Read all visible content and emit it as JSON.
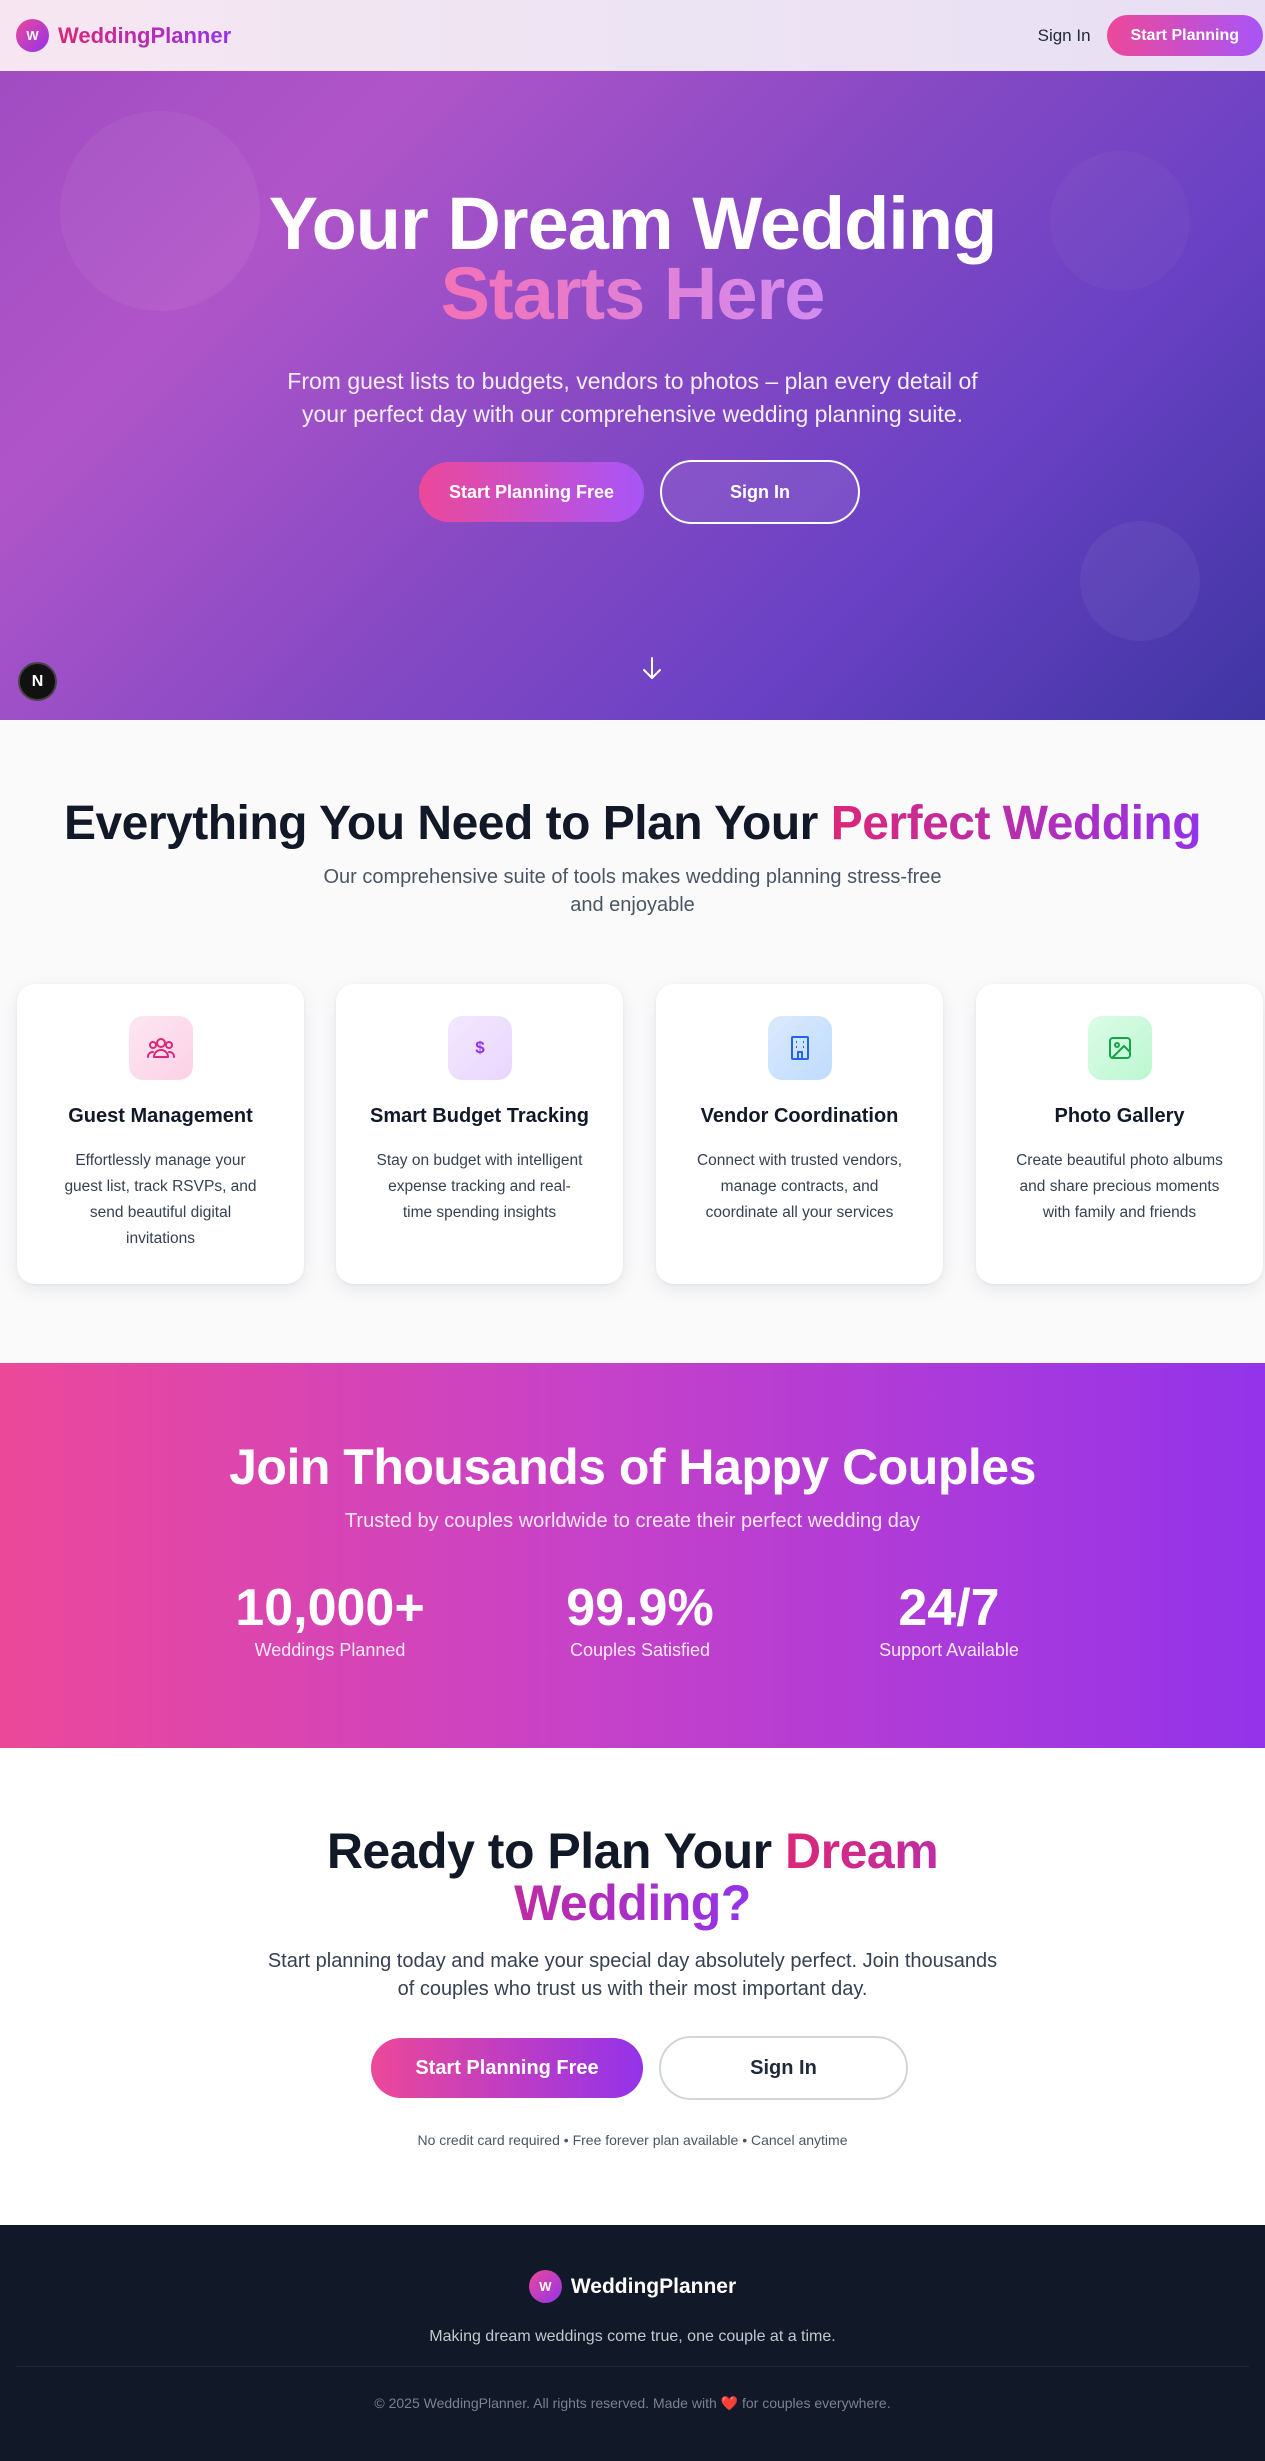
{
  "header": {
    "logo_letter": "W",
    "brand": "WeddingPlanner",
    "signin_label": "Sign In",
    "cta_label": "Start Planning"
  },
  "hero": {
    "title_line1": "Your Dream Wedding",
    "title_line2": "Starts Here",
    "subtitle": "From guest lists to budgets, vendors to photos – plan every detail of your perfect day with our comprehensive wedding planning suite.",
    "primary_button": "Start Planning Free",
    "secondary_button": "Sign In",
    "badge_letter": "N",
    "scroll_icon": "arrow-down-icon"
  },
  "features": {
    "title_plain": "Everything You Need to Plan Your ",
    "title_highlight": "Perfect Wedding",
    "subtitle": "Our comprehensive suite of tools makes wedding planning stress-free and enjoyable",
    "cards": [
      {
        "icon": "users-icon",
        "title": "Guest Management",
        "description": "Effortlessly manage your guest list, track RSVPs, and send beautiful digital invitations"
      },
      {
        "icon": "dollar-icon",
        "title": "Smart Budget Tracking",
        "description": "Stay on budget with intelligent expense tracking and real-time spending insights"
      },
      {
        "icon": "building-icon",
        "title": "Vendor Coordination",
        "description": "Connect with trusted vendors, manage contracts, and coordinate all your services"
      },
      {
        "icon": "image-icon",
        "title": "Photo Gallery",
        "description": "Create beautiful photo albums and share precious moments with family and friends"
      }
    ],
    "dollar_glyph": "$"
  },
  "stats": {
    "title": "Join Thousands of Happy Couples",
    "subtitle": "Trusted by couples worldwide to create their perfect wedding day",
    "items": [
      {
        "value": "10,000+",
        "label": "Weddings Planned"
      },
      {
        "value": "99.9%",
        "label": "Couples Satisfied"
      },
      {
        "value": "24/7",
        "label": "Support Available"
      }
    ]
  },
  "cta": {
    "title_plain": "Ready to Plan Your ",
    "title_highlight": "Dream Wedding?",
    "subtitle": "Start planning today and make your special day absolutely perfect. Join thousands of couples who trust us with their most important day.",
    "primary_button": "Start Planning Free",
    "secondary_button": "Sign In",
    "note": "No credit card required • Free forever plan available • Cancel anytime"
  },
  "footer": {
    "logo_letter": "W",
    "brand": "WeddingPlanner",
    "tagline": "Making dream weddings come true, one couple at a time.",
    "copyright_before": "© 2025 WeddingPlanner. All rights reserved. Made with ",
    "heart": "❤️",
    "copyright_after": " for couples everywhere."
  },
  "colors": {
    "brand_pink": "#ec4899",
    "brand_purple": "#9333ea",
    "footer_bg": "#111827"
  }
}
